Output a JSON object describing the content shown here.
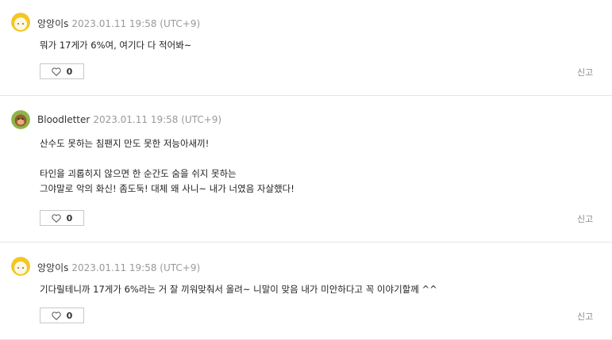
{
  "comments": [
    {
      "author": "앙앙이s",
      "date": "2023.01.11 19:58 (UTC+9)",
      "avatar_icon": "yellow-face-avatar",
      "text": "뭐가 17게가 6%여, 여기다 다 적어봐~",
      "likes": "0",
      "report": "신고"
    },
    {
      "author": "Bloodletter",
      "date": "2023.01.11 19:58 (UTC+9)",
      "avatar_icon": "green-monkey-avatar",
      "text": "산수도 못하는 침팬지 만도 못한 저능아새끼!\n\n타인을 괴롭히지 않으면 한 순간도 숨을 쉬지 못하는\n그야말로 악의 화신! 좀도둑! 대체 왜 사니~ 내가 너였음 자살했다!",
      "likes": "0",
      "report": "신고"
    },
    {
      "author": "앙앙이s",
      "date": "2023.01.11 19:58 (UTC+9)",
      "avatar_icon": "yellow-face-avatar",
      "text": "기다릴테니까 17게가 6%라는 거 잘 끼워맞춰서 올려~ 니말이 맞음 내가 미안하다고 꼭 이야기할께 ^^",
      "likes": "0",
      "report": "신고"
    }
  ],
  "colors": {
    "divider": "#e6e6e6",
    "date": "#999999",
    "report": "#888888"
  }
}
